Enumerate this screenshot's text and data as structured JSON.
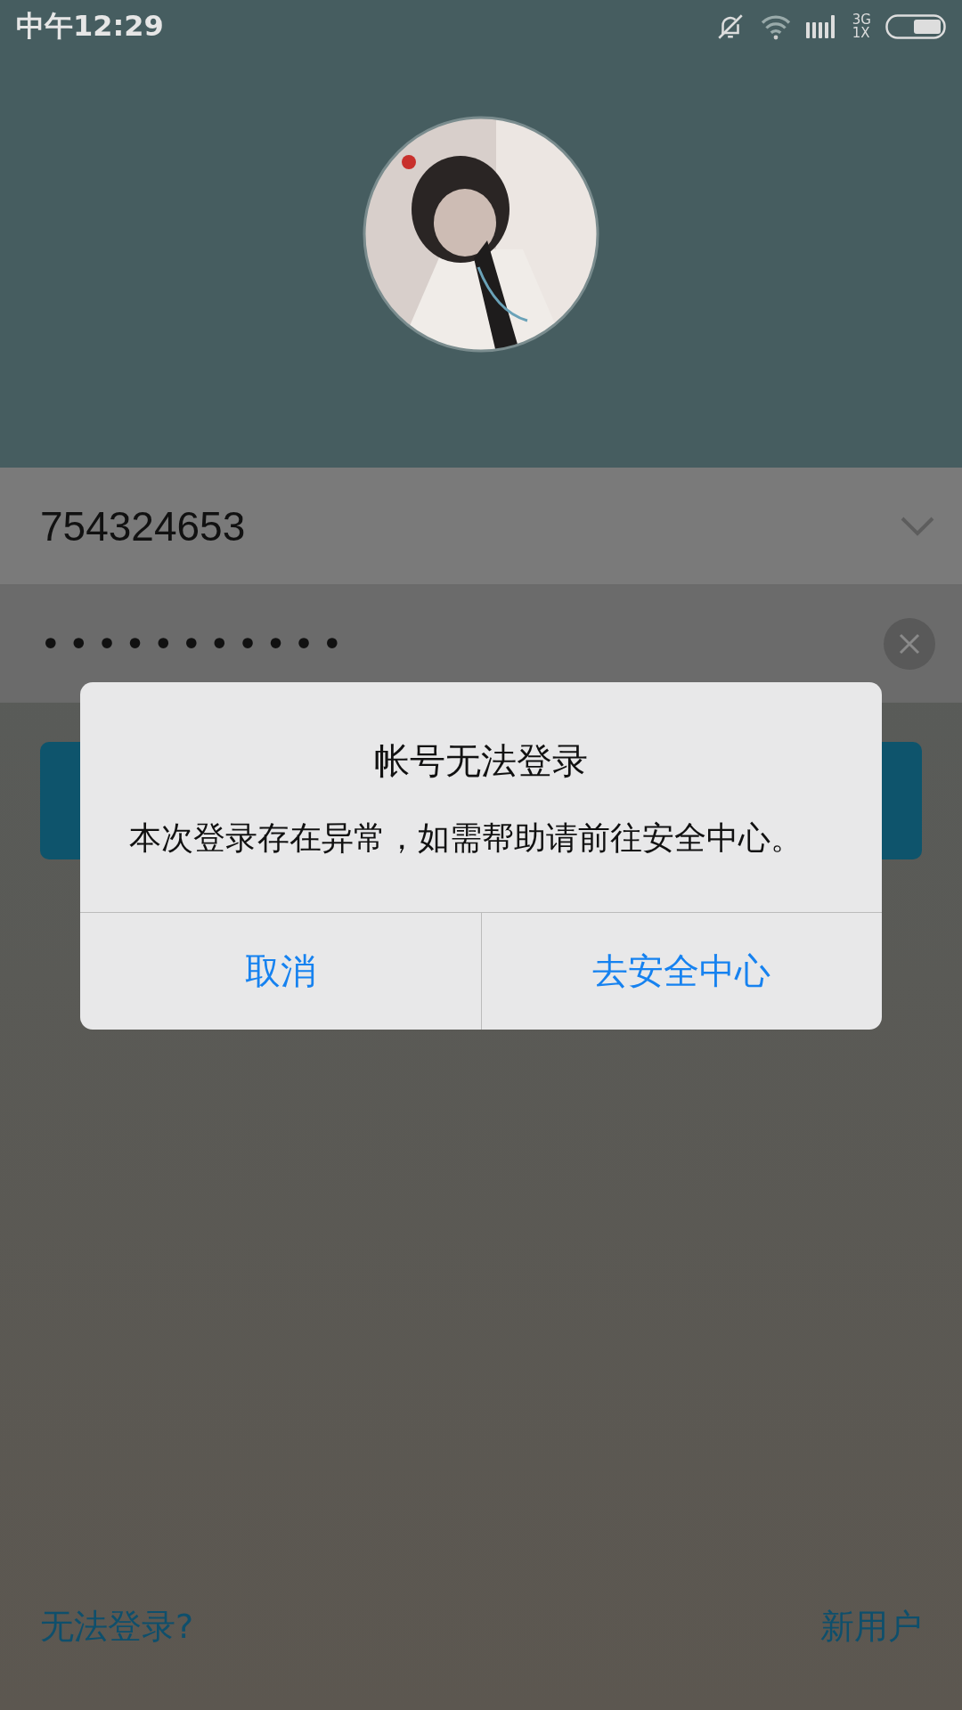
{
  "status_bar": {
    "time": "中午12:29",
    "network": "3G\n1X"
  },
  "account": {
    "value": "754324653"
  },
  "password": {
    "value": "•••••••••••"
  },
  "dialog": {
    "title": "帐号无法登录",
    "message": "本次登录存在异常，如需帮助请前往安全中心。",
    "buttons": [
      "取消",
      "去安全中心"
    ]
  },
  "links": [
    "无法登录?",
    "新用户"
  ]
}
